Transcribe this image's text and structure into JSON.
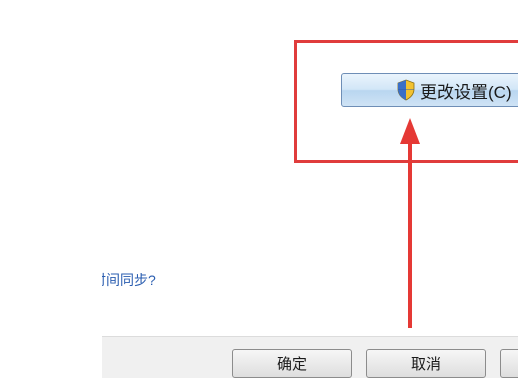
{
  "settings_panel": {
    "change_settings_label": "更改设置(C)"
  },
  "link": {
    "sync_text": "时间同步?"
  },
  "dialog_buttons": {
    "ok_label": "确定",
    "cancel_label": "取消",
    "apply_label": ""
  },
  "colors": {
    "highlight": "#e03c3c",
    "link": "#2a5db0"
  },
  "icons": {
    "uac_shield": "shield-icon"
  }
}
